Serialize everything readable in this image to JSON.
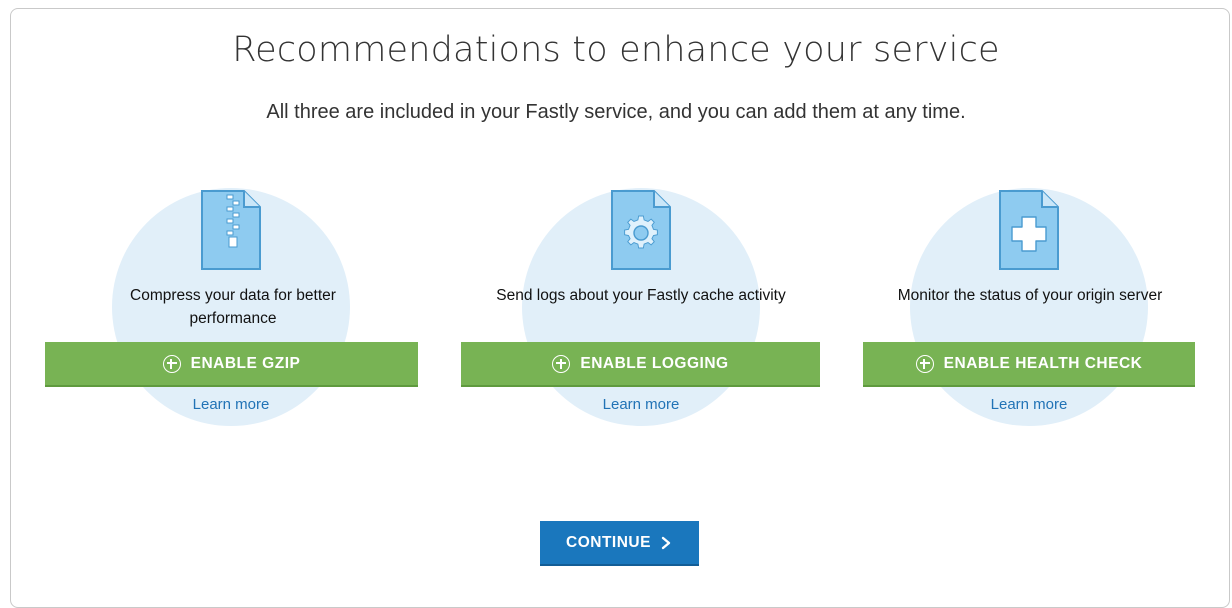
{
  "header": {
    "title": "Recommendations to enhance your service",
    "subtitle": "All three are included in your Fastly service, and you can add them at any time."
  },
  "cards": [
    {
      "icon": "zip-file-icon",
      "description": "Compress your data for better performance",
      "button_label": "ENABLE GZIP",
      "link_label": "Learn more"
    },
    {
      "icon": "gear-file-icon",
      "description": "Send logs about your Fastly cache activity",
      "button_label": "ENABLE LOGGING",
      "link_label": "Learn more"
    },
    {
      "icon": "health-plus-file-icon",
      "description": "Monitor the status of your origin server",
      "button_label": "ENABLE HEALTH CHECK",
      "link_label": "Learn more"
    }
  ],
  "footer": {
    "continue_label": "CONTINUE"
  },
  "colors": {
    "enable_button": "#78b354",
    "continue_button": "#1a77bd",
    "circle_bg": "#e1eff9",
    "link": "#2173b6",
    "icon_fill": "#8ecbf0",
    "icon_stroke": "#4a9bd0"
  }
}
